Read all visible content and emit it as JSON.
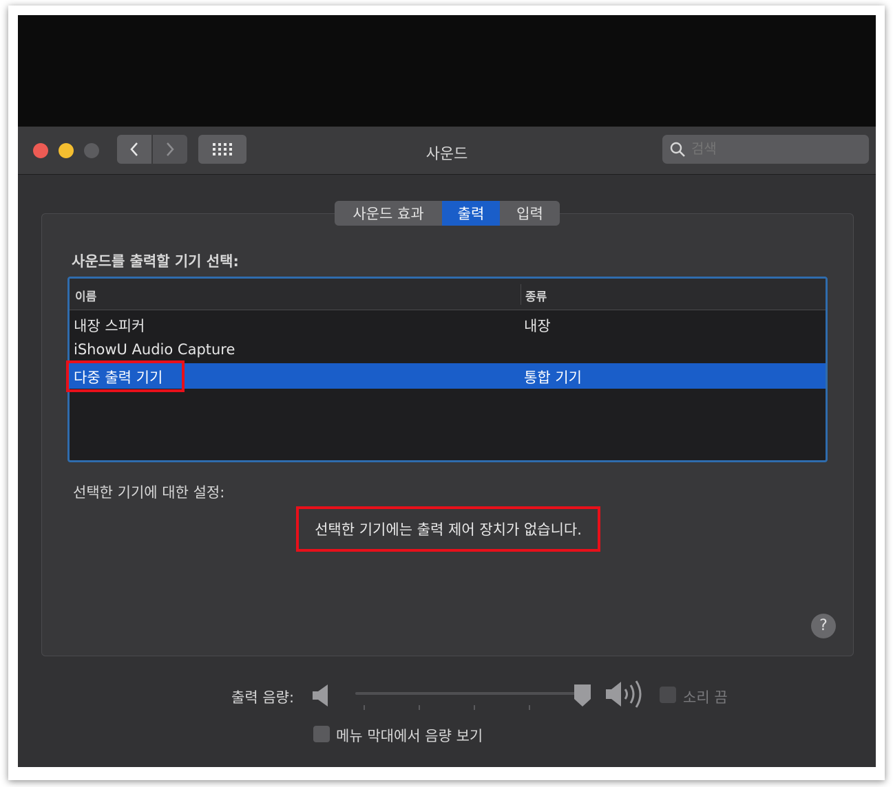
{
  "window": {
    "title": "사운드"
  },
  "toolbar": {
    "back": "‹",
    "forward": "›",
    "grid": "⋮⋮⋮"
  },
  "search": {
    "placeholder": "검색"
  },
  "tabs": [
    {
      "label": "사운드 효과",
      "active": false
    },
    {
      "label": "출력",
      "active": true
    },
    {
      "label": "입력",
      "active": false
    }
  ],
  "device_section": {
    "heading": "사운드를 출력할 기기 선택:"
  },
  "table": {
    "columns": [
      "이름",
      "종류"
    ],
    "rows": [
      {
        "name": "내장 스피커",
        "type": "내장",
        "selected": false
      },
      {
        "name": "iShowU Audio Capture",
        "type": "",
        "selected": false
      },
      {
        "name": "다중 출력 기기",
        "type": "통합 기기",
        "selected": true
      }
    ]
  },
  "settings": {
    "heading": "선택한 기기에 대한 설정:",
    "message": "선택한 기기에는 출력 제어 장치가 없습니다."
  },
  "help": "?",
  "volume": {
    "label": "출력 음량:",
    "level": 0.97,
    "mute_label": "소리 끔",
    "mute_checked": false
  },
  "menubar_option": {
    "label": "메뉴 막대에서 음량 보기",
    "checked": false
  },
  "colors": {
    "accent": "#1a5ec9",
    "annotation_red": "#e8101a",
    "close": "#ed5b54",
    "minimize": "#f4be30",
    "zoom_disabled": "#5c5c5f"
  }
}
